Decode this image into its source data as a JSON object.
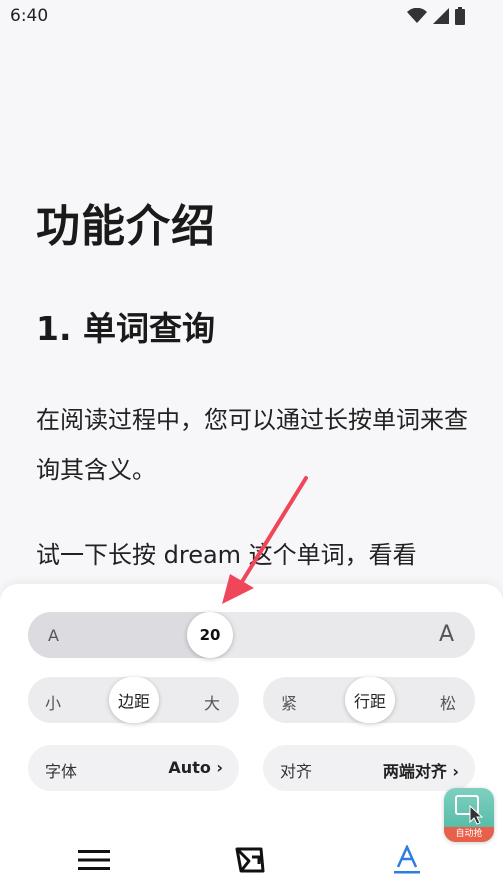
{
  "status_bar": {
    "time": "6:40",
    "icons": [
      "wifi-icon",
      "signal-icon",
      "battery-icon"
    ]
  },
  "article": {
    "title": "功能介绍",
    "subtitle": "1. 单词查询",
    "paragraph1": "在阅读过程中，您可以通过长按单词来查询其含义。",
    "paragraph2": "试一下长按 dream 这个单词，看看"
  },
  "settings_panel": {
    "font_size": {
      "small_label": "A",
      "large_label": "A",
      "value": "20"
    },
    "margin": {
      "left": "小",
      "center": "边距",
      "right": "大"
    },
    "line_spacing": {
      "left": "紧",
      "center": "行距",
      "right": "松"
    },
    "font": {
      "label": "字体",
      "value": "Auto ›"
    },
    "alignment": {
      "label": "对齐",
      "value": "两端对齐 ›"
    }
  },
  "bottom_nav": {
    "items": [
      "menu-icon",
      "page-turn-icon",
      "text-style-icon"
    ],
    "active": "text-style-icon"
  },
  "floating_app": {
    "label": "自动抢"
  },
  "colors": {
    "accent": "#2e7de0",
    "arrow": "#f0465a",
    "panel_bg": "#ffffff",
    "page_bg": "#f7f7f9"
  }
}
